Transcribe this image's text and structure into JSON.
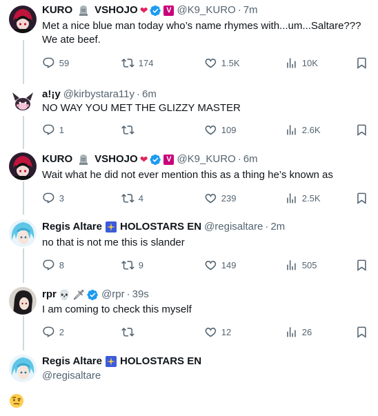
{
  "tweets": [
    {
      "name": "KURO",
      "name_suffix": "VSHOJO",
      "badges": [
        "tombstone-emoji",
        "heart-ribbon-emoji",
        "verified-badge",
        "vshojo-v-badge"
      ],
      "handle": "@K9_KURO",
      "time": "7m",
      "text_lines": [
        "Met a nice blue man today who’s name rhymes with...um...Saltare???",
        "We ate beef."
      ],
      "actions": {
        "replies": "59",
        "reposts": "174",
        "likes": "1.5K",
        "views": "10K"
      }
    },
    {
      "name": "a!¡y",
      "handle": "@kirbystara11y",
      "time": "6m",
      "text_lines": [
        "NO WAY YOU MET THE GLIZZY MASTER"
      ],
      "actions": {
        "replies": "1",
        "reposts": "",
        "likes": "109",
        "views": "2.6K"
      }
    },
    {
      "name": "KURO",
      "name_suffix": "VSHOJO",
      "handle": "@K9_KURO",
      "time": "6m",
      "text_lines": [
        "Wait what he did not ever mention this as a thing he’s known as"
      ],
      "actions": {
        "replies": "3",
        "reposts": "4",
        "likes": "239",
        "views": "2.5K"
      }
    },
    {
      "name": "Regis Altare",
      "name_suffix": "HOLOSTARS EN",
      "handle": "@regisaltare",
      "time": "2m",
      "text_lines": [
        "no that is not me this is slander"
      ],
      "actions": {
        "replies": "8",
        "reposts": "9",
        "likes": "149",
        "views": "505"
      }
    },
    {
      "name": "rpr",
      "handle": "@rpr",
      "time": "39s",
      "text_lines": [
        "I am coming to check this myself"
      ],
      "actions": {
        "replies": "2",
        "reposts": "",
        "likes": "12",
        "views": "26"
      }
    }
  ],
  "reply_author": {
    "name": "Regis Altare",
    "name_suffix": "HOLOSTARS EN",
    "handle": "@regisaltare"
  },
  "reply_emoji": "🤨",
  "colors": {
    "text": "#0f1419",
    "secondary": "#536471",
    "verified": "#1d9bf0",
    "thread_line": "#cfd9de",
    "vshojo": "#c8007a"
  }
}
